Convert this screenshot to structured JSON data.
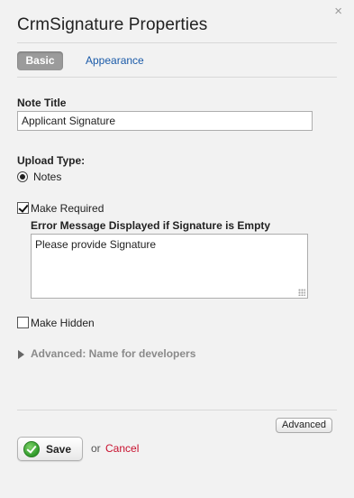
{
  "dialog": {
    "title": "CrmSignature Properties",
    "close_icon": "close-icon",
    "close_glyph": "×"
  },
  "tabs": [
    {
      "label": "Basic",
      "active": true
    },
    {
      "label": "Appearance",
      "active": false
    }
  ],
  "note_title": {
    "label": "Note Title",
    "value": "Applicant Signature"
  },
  "upload_type": {
    "label": "Upload Type:",
    "selected": "Notes"
  },
  "make_required": {
    "label": "Make Required",
    "checked": true
  },
  "error_message": {
    "label": "Error Message Displayed if Signature is Empty",
    "value": "Please provide Signature"
  },
  "make_hidden": {
    "label": "Make Hidden",
    "checked": false
  },
  "advanced_section": {
    "label": "Advanced: Name for developers",
    "expanded": false
  },
  "footer": {
    "advanced_button": "Advanced",
    "save_button": "Save",
    "or_text": "or",
    "cancel_link": "Cancel"
  },
  "colors": {
    "link": "#1a5aa8",
    "cancel": "#c8102e",
    "active_tab": "#9b9b9b",
    "save_icon": "#2f9a2a"
  }
}
